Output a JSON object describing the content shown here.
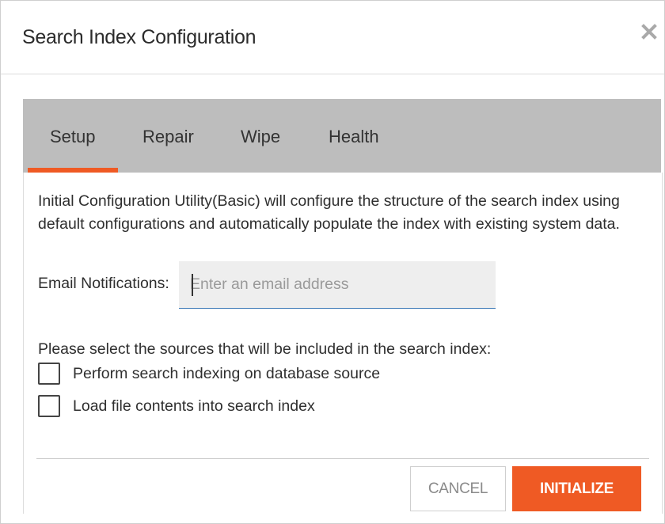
{
  "dialog": {
    "title": "Search Index Configuration",
    "close_icon": "close-icon"
  },
  "tabs": [
    {
      "label": "Setup",
      "active": true
    },
    {
      "label": "Repair",
      "active": false
    },
    {
      "label": "Wipe",
      "active": false
    },
    {
      "label": "Health",
      "active": false
    }
  ],
  "setup": {
    "description": "Initial Configuration Utility(Basic) will configure the structure of the search index using default configurations and automatically populate the index with existing system data.",
    "email_label": "Email Notifications:",
    "email_placeholder": "Enter an email address",
    "email_value": "",
    "sources_label": "Please select the sources that will be included in the search index:",
    "sources": [
      {
        "label": "Perform search indexing on database source",
        "checked": false
      },
      {
        "label": "Load file contents into search index",
        "checked": false
      }
    ]
  },
  "footer": {
    "cancel_label": "CANCEL",
    "initialize_label": "INITIALIZE"
  },
  "colors": {
    "accent": "#ef5a24",
    "tabbar_bg": "#bdbdbd",
    "input_bg": "#eeeeee",
    "input_underline": "#3b79b6"
  }
}
